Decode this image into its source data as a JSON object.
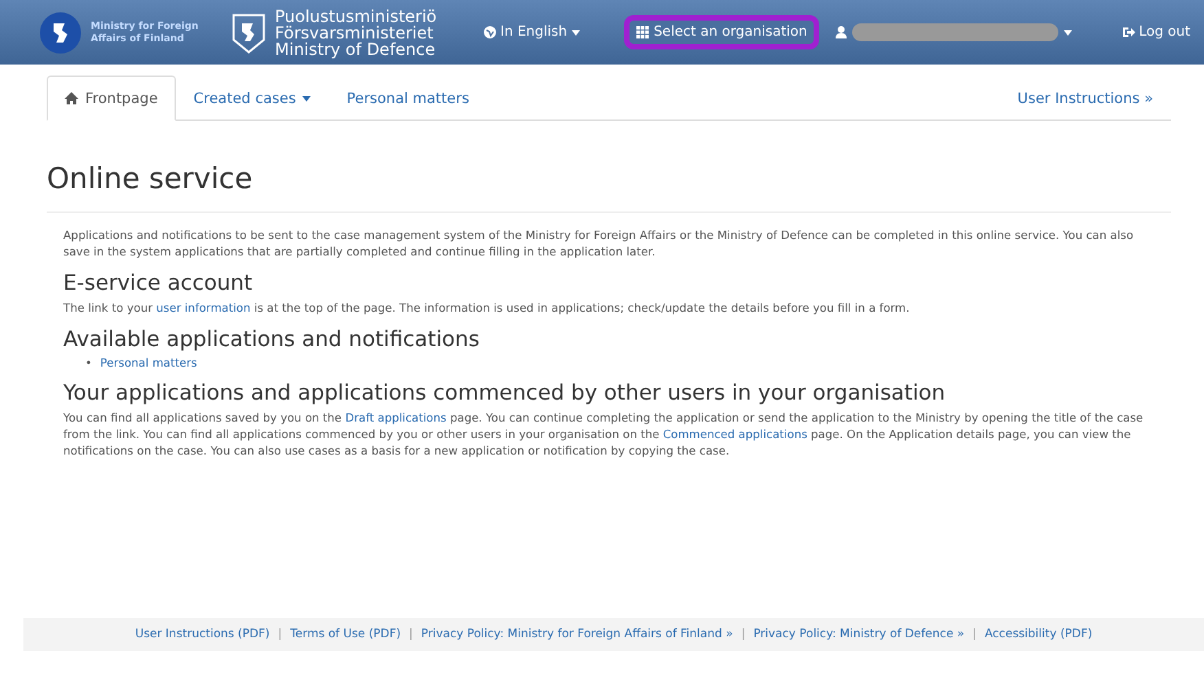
{
  "header": {
    "logo_left": [
      "Ministry for Foreign",
      "Affairs of Finland"
    ],
    "logo_right": [
      "Puolustusministeriö",
      "Försvarsministeriet",
      "Ministry of Defence"
    ],
    "language": "In English",
    "organisation": "Select an organisation",
    "organisation_highlighted": true,
    "logout": "Log out"
  },
  "tabs": [
    {
      "label": "Frontpage",
      "selected": true,
      "kind": "home"
    },
    {
      "label": "Created cases",
      "selected": false,
      "kind": "dropdown"
    },
    {
      "label": "Personal matters",
      "selected": false,
      "kind": "plain"
    }
  ],
  "user_instructions": "User Instructions »",
  "title": "Online service",
  "sections": [
    {
      "paragraph": [
        {
          "kind": "text",
          "text": "Applications and notifications to be sent to the case management system of the Ministry for Foreign Affairs or the Ministry of Defence can be completed in this online service. You can also save in the system applications that are partially completed and continue filling in the application later."
        }
      ]
    },
    {
      "heading": "E-service account",
      "paragraph": [
        {
          "kind": "text",
          "text": "The link to your "
        },
        {
          "kind": "link",
          "text": "user information"
        },
        {
          "kind": "text",
          "text": " is at the top of the page. The information is used in applications; check/update the details before you fill in a form."
        }
      ]
    },
    {
      "heading": "Available applications and notifications",
      "list": [
        {
          "marker": "•",
          "label": "Personal matters"
        }
      ]
    },
    {
      "heading": "Your applications and applications commenced by other users in your organisation",
      "paragraph": [
        {
          "kind": "text",
          "text": "You can find all applications saved by you on the "
        },
        {
          "kind": "link",
          "text": "Draft applications"
        },
        {
          "kind": "text",
          "text": " page. You can continue completing the application or send the application to the Ministry by opening the title of the case from the link. You can find all applications commenced by you or other users in your organisation on the "
        },
        {
          "kind": "link",
          "text": "Commenced applications"
        },
        {
          "kind": "text",
          "text": " page. On the Application details page, you can view the notifications on the case. You can also use cases as a basis for a new application or notification by copying the case."
        }
      ]
    }
  ],
  "footer": [
    {
      "kind": "link",
      "text": "User Instructions (PDF)"
    },
    {
      "kind": "separator",
      "text": "|"
    },
    {
      "kind": "link",
      "text": "Terms of Use (PDF)"
    },
    {
      "kind": "separator",
      "text": "|"
    },
    {
      "kind": "link",
      "text": "Privacy Policy: Ministry for Foreign Affairs of Finland »"
    },
    {
      "kind": "separator",
      "text": "|"
    },
    {
      "kind": "link",
      "text": "Privacy Policy: Ministry of Defence »"
    },
    {
      "kind": "separator",
      "text": "|"
    },
    {
      "kind": "link",
      "text": "Accessibility (PDF)"
    }
  ]
}
